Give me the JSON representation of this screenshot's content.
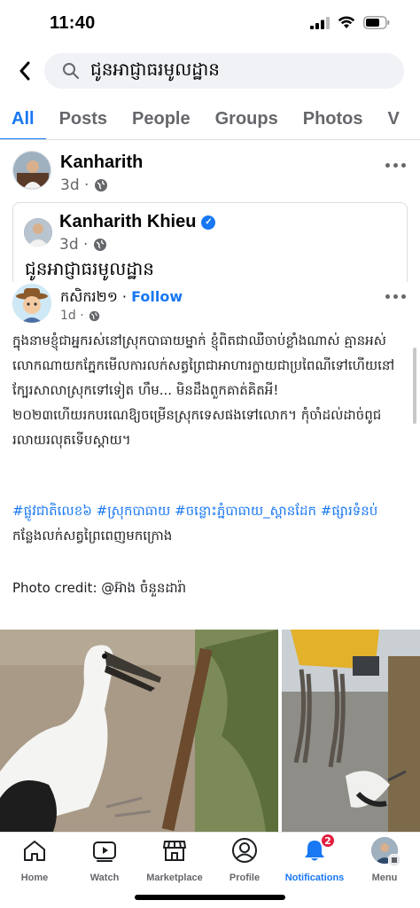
{
  "status_bar": {
    "time": "11:40"
  },
  "search": {
    "query": "ជូនអាជ្ញាធរមូលដ្ឋាន"
  },
  "tabs": [
    "All",
    "Posts",
    "People",
    "Groups",
    "Photos",
    "V"
  ],
  "post": {
    "author": "Kanharith",
    "time": "3d ·",
    "shared": {
      "author": "Kanharith Khieu",
      "time": "3d ·",
      "caption": "ជូនអាជ្ញាធរមូលដ្ឋាន"
    }
  },
  "embedded_post": {
    "author": "កសិករ២១",
    "separator": " · ",
    "follow_label": "Follow",
    "time": "1d ·",
    "body": "ក្នុងនាមខ្ញុំជាអ្នករស់នៅស្រុកបាធាយម្នាក់ ខ្ញុំពិតជាឈឺចាប់ខ្លាំងណាស់ គ្មានអស់លោកណាយកភ្នែកមើលការលក់សត្វព្រៃជាអាហារក្លាយជាប្រពៃណីទៅហើយនៅក្បែរសាលាស្រុកទៅទៀត ហឹម... មិនដឹងពួកគាត់គិតអី! ២០២៣ហើយរកបរណេឱ្យចម្រើនស្រុកទេសផងទៅលោក។ កុំចាំដល់ដាច់ពូជរលាយរលុតទើបស្តាយ។",
    "tags": [
      "#ផ្លូវជាតិលេខ៦",
      "#ស្រុកបាធាយ",
      "#ចន្លោះភ្នំបាធាយ_ស្ពានដែក",
      "#ផ្សារទំនប់"
    ],
    "tags_suffix": "កន្លែងលក់សត្វព្រៃពេញមកក្រោង",
    "credit": "Photo credit: @អ៊ាង ចំនួនដារ៉ា"
  },
  "bottom_nav": {
    "items": [
      {
        "label": "Home",
        "icon": "home-icon"
      },
      {
        "label": "Watch",
        "icon": "watch-icon"
      },
      {
        "label": "Marketplace",
        "icon": "marketplace-icon"
      },
      {
        "label": "Profile",
        "icon": "profile-icon"
      },
      {
        "label": "Notifications",
        "icon": "bell-icon"
      },
      {
        "label": "Menu",
        "icon": "menu-avatar-icon"
      }
    ],
    "notification_count": "2"
  },
  "colors": {
    "accent": "#1877f2",
    "badge": "#e41e3f",
    "muted": "#65676b"
  }
}
